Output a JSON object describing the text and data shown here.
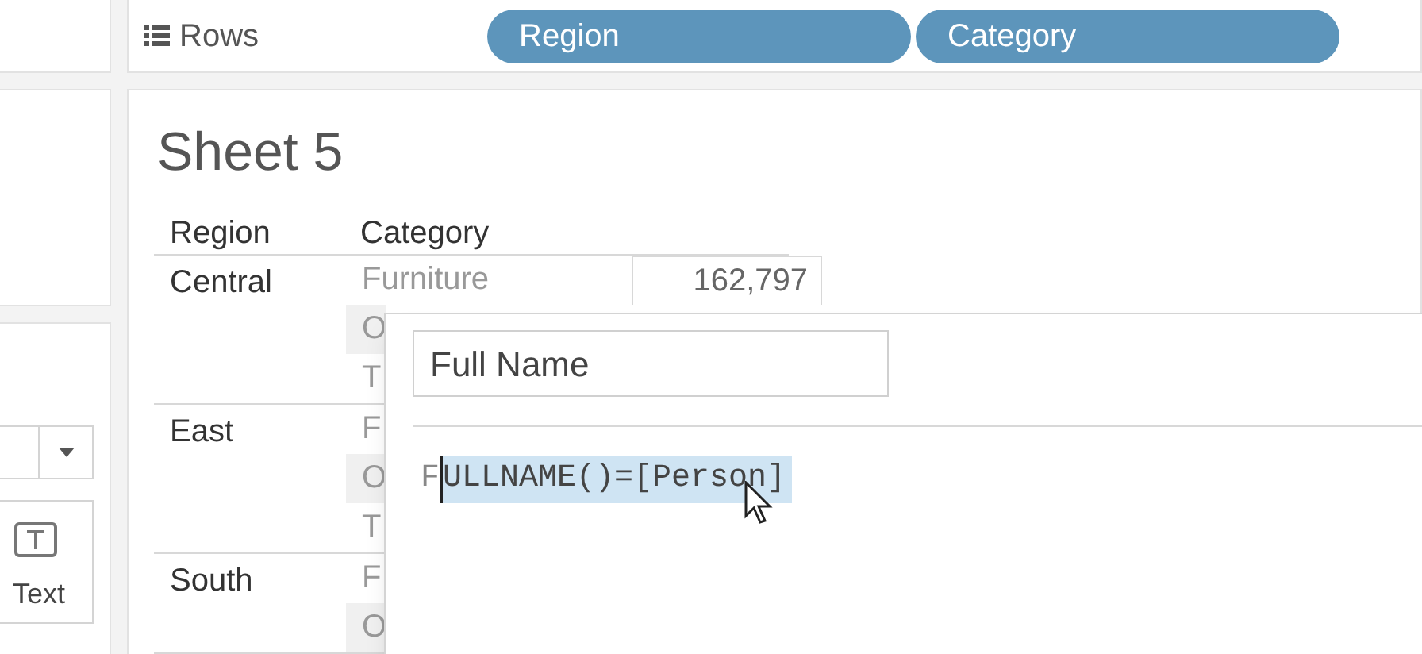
{
  "rows_shelf": {
    "label": "Rows",
    "pills": [
      "Region",
      "Category"
    ]
  },
  "marks_card": {
    "buttons": [
      {
        "label": "Text"
      }
    ]
  },
  "sheet": {
    "title": "Sheet 5",
    "columns": [
      "Region",
      "Category"
    ],
    "groups": [
      {
        "region": "Central",
        "rows": [
          {
            "category": "Furniture",
            "value": "162,797"
          },
          {
            "category": "O"
          },
          {
            "category": "T"
          }
        ]
      },
      {
        "region": "East",
        "rows": [
          {
            "category": "F"
          },
          {
            "category": "O"
          },
          {
            "category": "T"
          }
        ]
      },
      {
        "region": "South",
        "rows": [
          {
            "category": "F"
          },
          {
            "category": "O"
          }
        ]
      }
    ]
  },
  "calc_editor": {
    "name": "Full Name",
    "formula_unselected": "F",
    "formula_selected": "ULLNAME()=[Person]"
  }
}
